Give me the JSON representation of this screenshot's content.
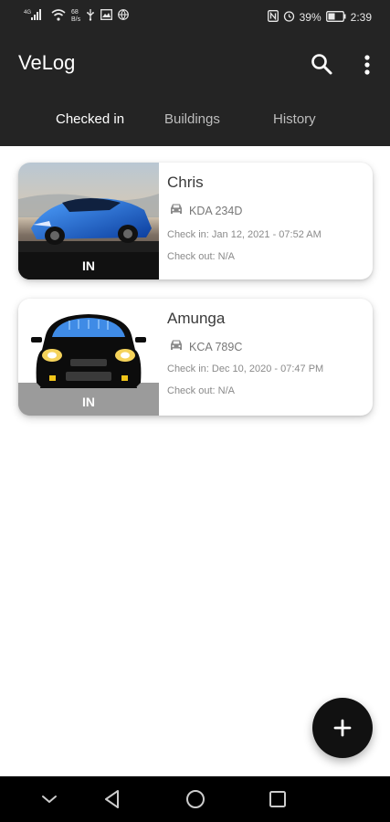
{
  "statusbar": {
    "signal_label": "4G",
    "speed_top": "68",
    "speed_bottom": "B/s",
    "battery_percent": "39%",
    "time": "2:39"
  },
  "appbar": {
    "title": "VeLog",
    "tabs": [
      {
        "label": "Checked in",
        "active": true
      },
      {
        "label": "Buildings",
        "active": false
      },
      {
        "label": "History",
        "active": false
      }
    ]
  },
  "vehicles": [
    {
      "name": "Chris",
      "plate": "KDA 234D",
      "check_in": "Check in: Jan 12, 2021 - 07:52 AM",
      "check_out": "Check out: N/A",
      "status": "IN",
      "thumbnail": "blue-sports-car-photo"
    },
    {
      "name": "Amunga",
      "plate": "KCA 789C",
      "check_in": "Check in: Dec 10, 2020 - 07:47 PM",
      "check_out": "Check out: N/A",
      "status": "IN",
      "thumbnail": "car-front-illustration"
    }
  ],
  "icons": {
    "search": "search-icon",
    "more": "more-vert-icon",
    "plate": "car-icon",
    "fab": "add-icon",
    "nav_down": "chevron-down-icon",
    "nav_back": "back-triangle-icon",
    "nav_home": "home-circle-icon",
    "nav_recent": "recent-square-icon"
  },
  "colors": {
    "appbar": "#242424",
    "fab": "#111111",
    "navbar": "#000000"
  }
}
